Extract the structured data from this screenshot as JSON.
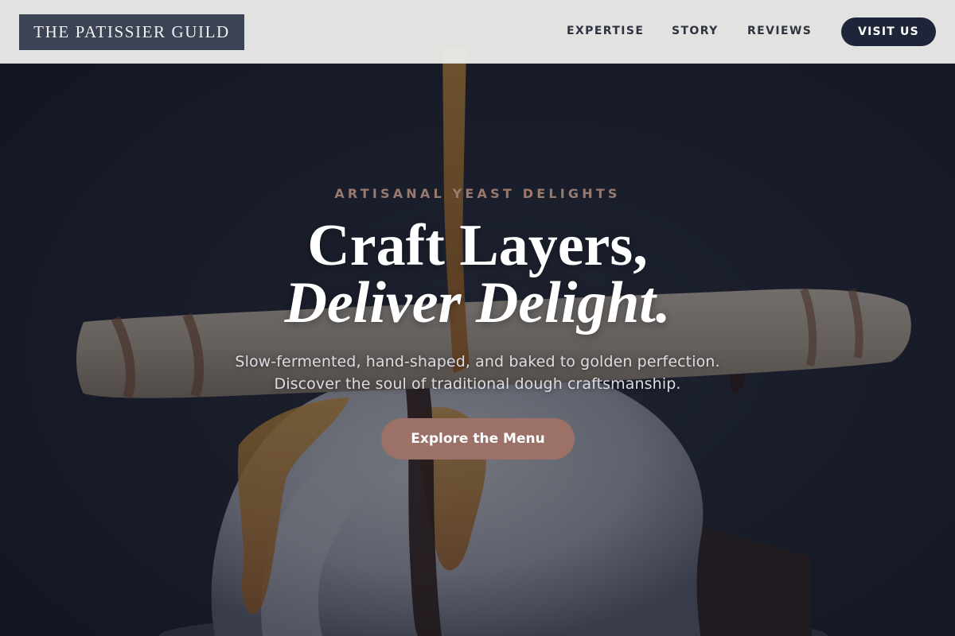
{
  "header": {
    "logo_text": "THE PATISSIER GUILD",
    "nav": [
      {
        "label": "EXPERTISE"
      },
      {
        "label": "STORY"
      },
      {
        "label": "REVIEWS"
      }
    ],
    "visit_label": "VISIT US"
  },
  "hero": {
    "eyebrow": "ARTISANAL YEAST DELIGHTS",
    "headline_line1": "Craft Layers,",
    "headline_line2": "Deliver Delight.",
    "subline_1": "Slow-fermented, hand-shaped, and baked to golden perfection.",
    "subline_2": "Discover the soul of traditional dough craftsmanship.",
    "cta_label": "Explore the Menu"
  },
  "colors": {
    "header_bg": "#ebebe8",
    "logo_bg": "#3c4355",
    "nav_text": "#2f3340",
    "visit_button_bg": "#1e2538",
    "hero_overlay": "#141824",
    "eyebrow": "#9a7a6e",
    "cta_bg": "#9c7168"
  }
}
